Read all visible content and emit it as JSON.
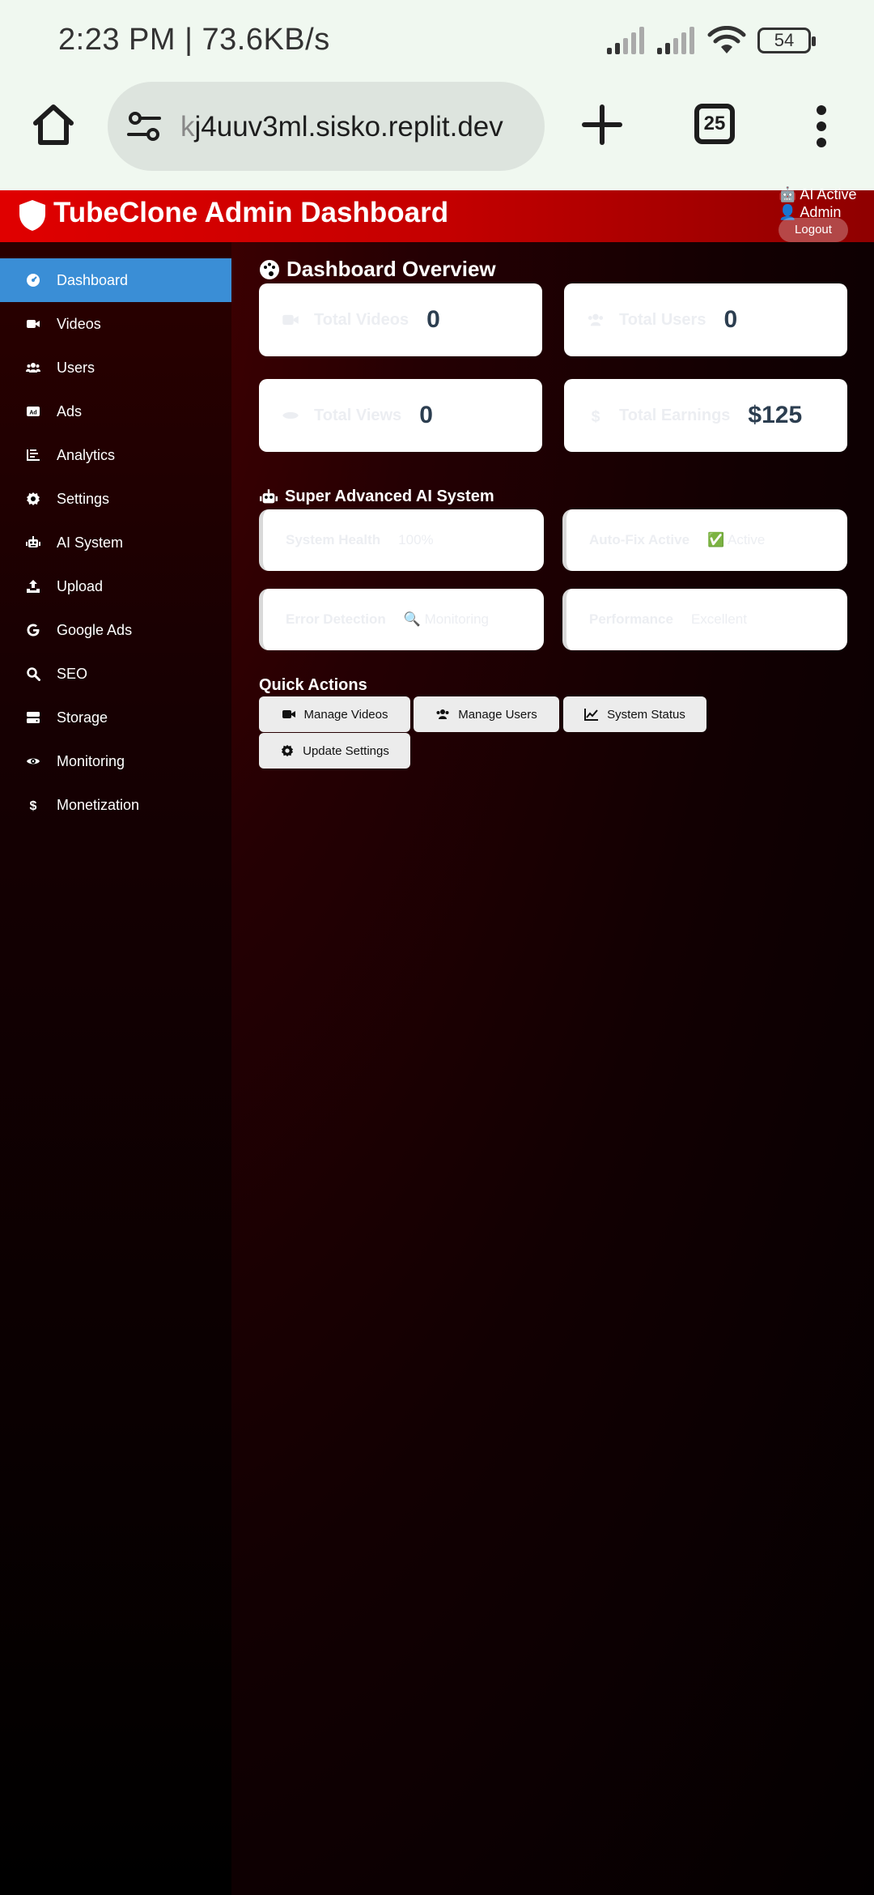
{
  "status": {
    "time": "2:23 PM | 73.6KB/s",
    "battery": "54"
  },
  "browser": {
    "url_faded": "k",
    "url_main": "j4uuv3ml.sisko.replit.dev",
    "tab_count": "25"
  },
  "header": {
    "title": "TubeClone Admin Dashboard",
    "ai_status": "AI Active",
    "user": "Admin",
    "logout": "Logout"
  },
  "sidebar": {
    "items": [
      {
        "label": "Dashboard",
        "icon": "tachometer-icon"
      },
      {
        "label": "Videos",
        "icon": "video-camera-icon"
      },
      {
        "label": "Users",
        "icon": "users-icon"
      },
      {
        "label": "Ads",
        "icon": "ad-icon"
      },
      {
        "label": "Analytics",
        "icon": "chart-bar-icon"
      },
      {
        "label": "Settings",
        "icon": "gear-icon"
      },
      {
        "label": "AI System",
        "icon": "robot-icon"
      },
      {
        "label": "Upload",
        "icon": "upload-icon"
      },
      {
        "label": "Google Ads",
        "icon": "google-icon"
      },
      {
        "label": "SEO",
        "icon": "search-icon"
      },
      {
        "label": "Storage",
        "icon": "hdd-icon"
      },
      {
        "label": "Monitoring",
        "icon": "eye-icon"
      },
      {
        "label": "Monetization",
        "icon": "dollar-icon"
      }
    ]
  },
  "overview": {
    "title": "Dashboard Overview",
    "stats": [
      {
        "label": "Total Videos",
        "value": "0",
        "icon": "video-camera-icon"
      },
      {
        "label": "Total Users",
        "value": "0",
        "icon": "users-icon"
      },
      {
        "label": "Total Views",
        "value": "0",
        "icon": "eye-icon"
      },
      {
        "label": "Total Earnings",
        "value": "$125",
        "icon": "dollar-icon"
      }
    ]
  },
  "ai_system": {
    "title": "Super Advanced AI System",
    "cards": [
      {
        "label": "System Health",
        "value": "100%"
      },
      {
        "label": "Auto-Fix Active",
        "value": "✅ Active"
      },
      {
        "label": "Error Detection",
        "value": "🔍 Monitoring"
      },
      {
        "label": "Performance",
        "value": "Excellent"
      }
    ]
  },
  "quick_actions": {
    "title": "Quick Actions",
    "buttons": [
      {
        "label": "Manage Videos",
        "icon": "video-camera-icon"
      },
      {
        "label": "Manage Users",
        "icon": "users-icon"
      },
      {
        "label": "System Status",
        "icon": "line-chart-icon"
      },
      {
        "label": "Update Settings",
        "icon": "gear-icon"
      }
    ]
  },
  "colors": {
    "header_red": "#e00000",
    "active_blue": "#3a8ed6",
    "value_dark": "#2c3e50"
  }
}
